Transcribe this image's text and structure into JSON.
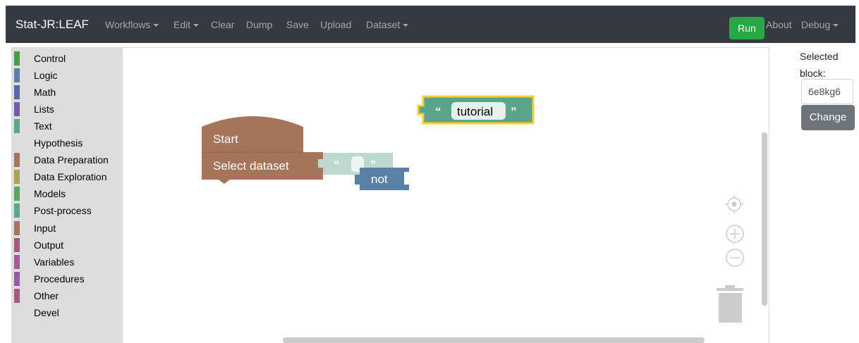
{
  "navbar": {
    "brand": "Stat-JR:LEAF",
    "menus": [
      {
        "label": "Workflows",
        "has_caret": true
      },
      {
        "label": "Edit",
        "has_caret": true
      },
      {
        "label": "Clear",
        "has_caret": false
      },
      {
        "label": "Dump",
        "has_caret": false
      },
      {
        "label": "Save",
        "has_caret": false
      },
      {
        "label": "Upload",
        "has_caret": false
      },
      {
        "label": "Dataset",
        "has_caret": true
      }
    ],
    "run_label": "Run",
    "about_label": "About",
    "debug_label": "Debug",
    "colors": {
      "background": "#343a40",
      "run": "#28a745"
    }
  },
  "toolbox": {
    "categories": [
      {
        "label": "Control",
        "color": "#4a9a4a"
      },
      {
        "label": "Logic",
        "color": "#5b80a5"
      },
      {
        "label": "Math",
        "color": "#5b67a5"
      },
      {
        "label": "Lists",
        "color": "#745ba5"
      },
      {
        "label": "Text",
        "color": "#5ba58c"
      },
      {
        "label": "Hypothesis",
        "color": ""
      },
      {
        "label": "Data Preparation",
        "color": "#a5745b"
      },
      {
        "label": "Data Exploration",
        "color": "#a5a55b"
      },
      {
        "label": "Models",
        "color": "#5ba55b"
      },
      {
        "label": "Post-process",
        "color": "#5ba58c"
      },
      {
        "label": "Input",
        "color": "#a5745b"
      },
      {
        "label": "Output",
        "color": "#a55b80"
      },
      {
        "label": "Variables",
        "color": "#a55b99"
      },
      {
        "label": "Procedures",
        "color": "#995ba5"
      },
      {
        "label": "Other",
        "color": "#a55b80"
      },
      {
        "label": "Devel",
        "color": ""
      }
    ]
  },
  "workspace": {
    "blocks": {
      "tutorial_text": "tutorial",
      "start_label": "Start",
      "select_dataset_label": "Select dataset",
      "not_label": "not",
      "quote_open": "“",
      "quote_close": "”"
    },
    "colors": {
      "text_block": "#5ba58c",
      "procedure_block": "#a5745b",
      "logic_block": "#5b80a5",
      "selected_outline": "#fc3"
    }
  },
  "right_panel": {
    "selected_label": "Selected block:",
    "selected_value": "6e8kg6",
    "change_label": "Change"
  }
}
